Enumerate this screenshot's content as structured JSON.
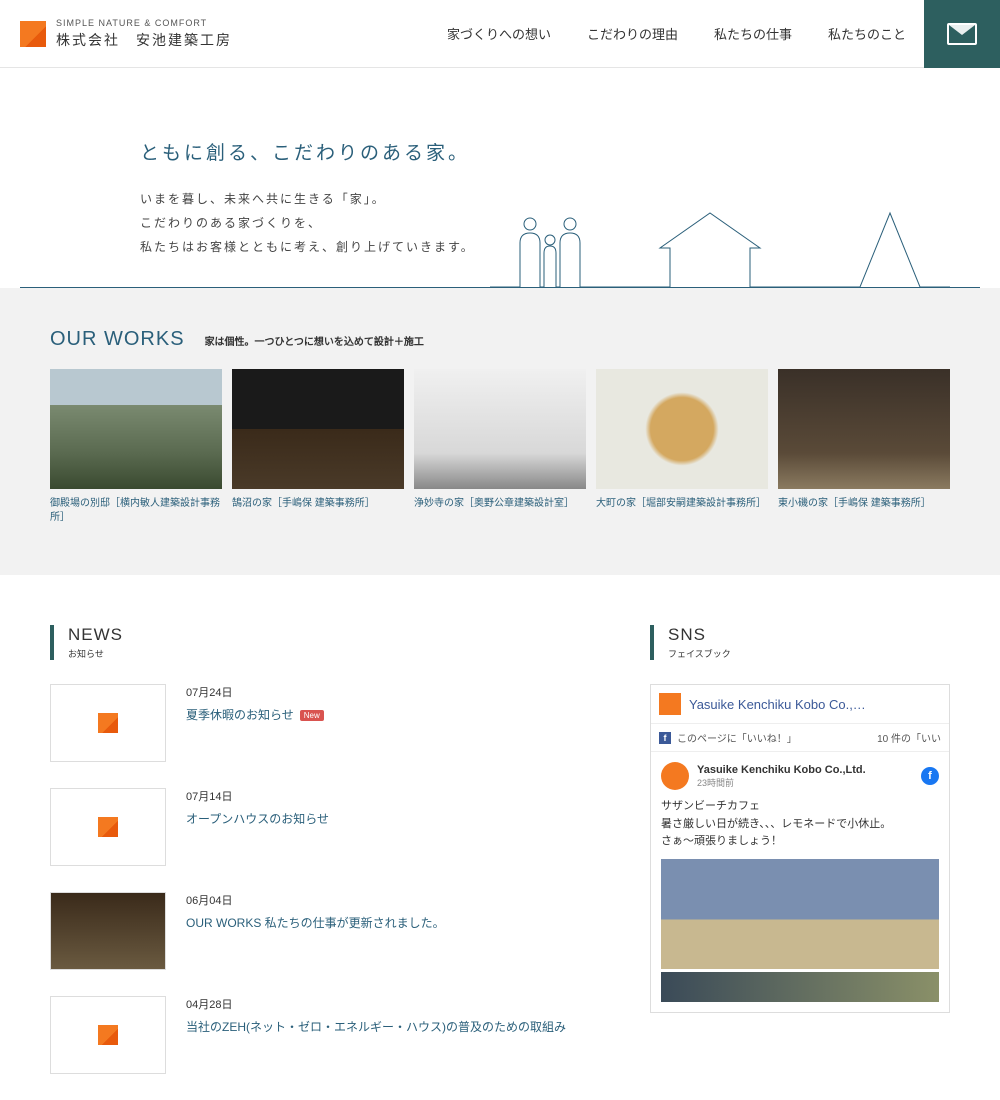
{
  "header": {
    "tagline": "SIMPLE NATURE & COMFORT",
    "company": "株式会社　安池建築工房",
    "nav": [
      "家づくりへの想い",
      "こだわりの理由",
      "私たちの仕事",
      "私たちのこと"
    ]
  },
  "hero": {
    "title": "ともに創る、こだわりのある家。",
    "line1": "いまを暮し、未来へ共に生きる「家」。",
    "line2": "こだわりのある家づくりを、",
    "line3": "私たちはお客様とともに考え、創り上げていきます。"
  },
  "works": {
    "title": "OUR WORKS",
    "subtitle": "家は個性。一つひとつに想いを込めて設計＋施工",
    "items": [
      "御殿場の別邸［横内敏人建築設計事務所］",
      "鵠沼の家［手嶋保 建築事務所］",
      "浄妙寺の家［奥野公章建築設計室］",
      "大町の家［堀部安嗣建築設計事務所］",
      "東小磯の家［手嶋保 建築事務所］"
    ]
  },
  "news": {
    "title": "NEWS",
    "subtitle": "お知らせ",
    "new_badge": "New",
    "items": [
      {
        "date": "07月24日",
        "title": "夏季休暇のお知らせ",
        "is_new": true,
        "thumb": "logo"
      },
      {
        "date": "07月14日",
        "title": "オープンハウスのお知らせ",
        "is_new": false,
        "thumb": "logo"
      },
      {
        "date": "06月04日",
        "title": "OUR WORKS 私たちの仕事が更新されました。",
        "is_new": false,
        "thumb": "photo"
      },
      {
        "date": "04月28日",
        "title": "当社のZEH(ネット・ゼロ・エネルギー・ハウス)の普及のための取組み",
        "is_new": false,
        "thumb": "logo"
      }
    ]
  },
  "sns": {
    "title": "SNS",
    "subtitle": "フェイスブック",
    "page_name": "Yasuike Kenchiku Kobo Co.,…",
    "like_label": "このページに「いいね！」",
    "like_count": "10 件の「いい",
    "post": {
      "name": "Yasuike Kenchiku Kobo Co.,Ltd.",
      "time": "23時間前",
      "text1": "サザンビーチカフェ",
      "text2": "暑さ厳しい日が続き、、、レモネードで小休止。",
      "text3": "さぁ〜頑張りましょう！"
    }
  }
}
